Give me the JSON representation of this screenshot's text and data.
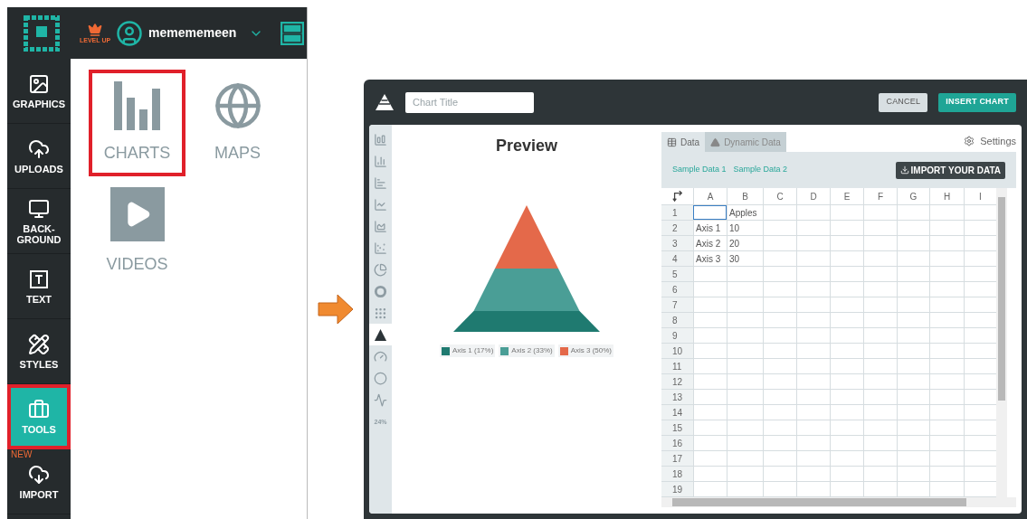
{
  "top_bar": {
    "badge": "LEVEL UP",
    "username": "memememeen"
  },
  "sidebar": {
    "items": [
      {
        "kind": "graphics",
        "label": "GRAPHICS",
        "selected": false,
        "highlighted": false
      },
      {
        "kind": "uploads",
        "label": "UPLOADS",
        "selected": false,
        "highlighted": false
      },
      {
        "kind": "background",
        "label": "BACK-GROUND",
        "selected": false,
        "highlighted": false
      },
      {
        "kind": "text",
        "label": "TEXT",
        "selected": false,
        "highlighted": false
      },
      {
        "kind": "styles",
        "label": "STYLES",
        "selected": false,
        "highlighted": false
      },
      {
        "kind": "tools",
        "label": "TOOLS",
        "selected": true,
        "highlighted": true
      },
      {
        "kind": "import",
        "label": "IMPORT",
        "selected": false,
        "highlighted": false,
        "badge": "NEW"
      }
    ]
  },
  "tools": [
    {
      "kind": "charts",
      "label": "CHARTS",
      "highlighted": true
    },
    {
      "kind": "maps",
      "label": "MAPS",
      "highlighted": false
    },
    {
      "kind": "videos",
      "label": "VIDEOS",
      "highlighted": false
    }
  ],
  "dialog": {
    "title_placeholder": "Chart Title",
    "buttons": {
      "cancel": "CANCEL",
      "insert": "INSERT CHART"
    },
    "chart_types": [
      {
        "kind": "column",
        "selected": false
      },
      {
        "kind": "histogram",
        "selected": false
      },
      {
        "kind": "bar",
        "selected": false
      },
      {
        "kind": "line",
        "selected": false
      },
      {
        "kind": "area",
        "selected": false
      },
      {
        "kind": "scatter",
        "selected": false
      },
      {
        "kind": "pie",
        "selected": false
      },
      {
        "kind": "donut",
        "selected": false
      },
      {
        "kind": "grid",
        "selected": false
      },
      {
        "kind": "pyramid",
        "selected": true
      },
      {
        "kind": "gauge",
        "selected": false
      },
      {
        "kind": "ring",
        "selected": false
      },
      {
        "kind": "sparkline",
        "selected": false
      },
      {
        "kind": "percent",
        "selected": false,
        "label": "24%"
      }
    ],
    "preview": {
      "title": "Preview",
      "legend": [
        {
          "label": "Axis 1 (17%)",
          "color": "#1f7a70"
        },
        {
          "label": "Axis 2 (33%)",
          "color": "#4a9e96"
        },
        {
          "label": "Axis 3 (50%)",
          "color": "#e4694a"
        }
      ]
    },
    "tabs": [
      {
        "kind": "data",
        "label": "Data",
        "selected": true
      },
      {
        "kind": "dynamic",
        "label": "Dynamic Data",
        "selected": false
      }
    ],
    "settings": "Settings",
    "samples": [
      "Sample Data 1",
      "Sample Data 2"
    ],
    "import_button": "IMPORT YOUR DATA",
    "grid": {
      "columns": [
        "A",
        "B",
        "C",
        "D",
        "E",
        "F",
        "G",
        "H",
        "I"
      ],
      "rows": [
        {
          "label": "1",
          "cell_b": "Apples",
          "cell_a_selected": true
        },
        {
          "label": "2",
          "cell_a": "Axis 1",
          "cell_b": "10",
          "cell_a_selected": false
        },
        {
          "label": "3",
          "cell_a": "Axis 2",
          "cell_b": "20",
          "cell_a_selected": false
        },
        {
          "label": "4",
          "cell_a": "Axis 3",
          "cell_b": "30",
          "cell_a_selected": false
        },
        {
          "label": "5",
          "cell_a_selected": false
        },
        {
          "label": "6",
          "cell_a_selected": false
        },
        {
          "label": "7",
          "cell_a_selected": false
        },
        {
          "label": "8",
          "cell_a_selected": false
        },
        {
          "label": "9",
          "cell_a_selected": false
        },
        {
          "label": "10",
          "cell_a_selected": false
        },
        {
          "label": "11",
          "cell_a_selected": false
        },
        {
          "label": "12",
          "cell_a_selected": false
        },
        {
          "label": "13",
          "cell_a_selected": false
        },
        {
          "label": "14",
          "cell_a_selected": false
        },
        {
          "label": "15",
          "cell_a_selected": false
        },
        {
          "label": "16",
          "cell_a_selected": false
        },
        {
          "label": "17",
          "cell_a_selected": false
        },
        {
          "label": "18",
          "cell_a_selected": false
        },
        {
          "label": "19",
          "cell_a_selected": false
        }
      ]
    }
  }
}
